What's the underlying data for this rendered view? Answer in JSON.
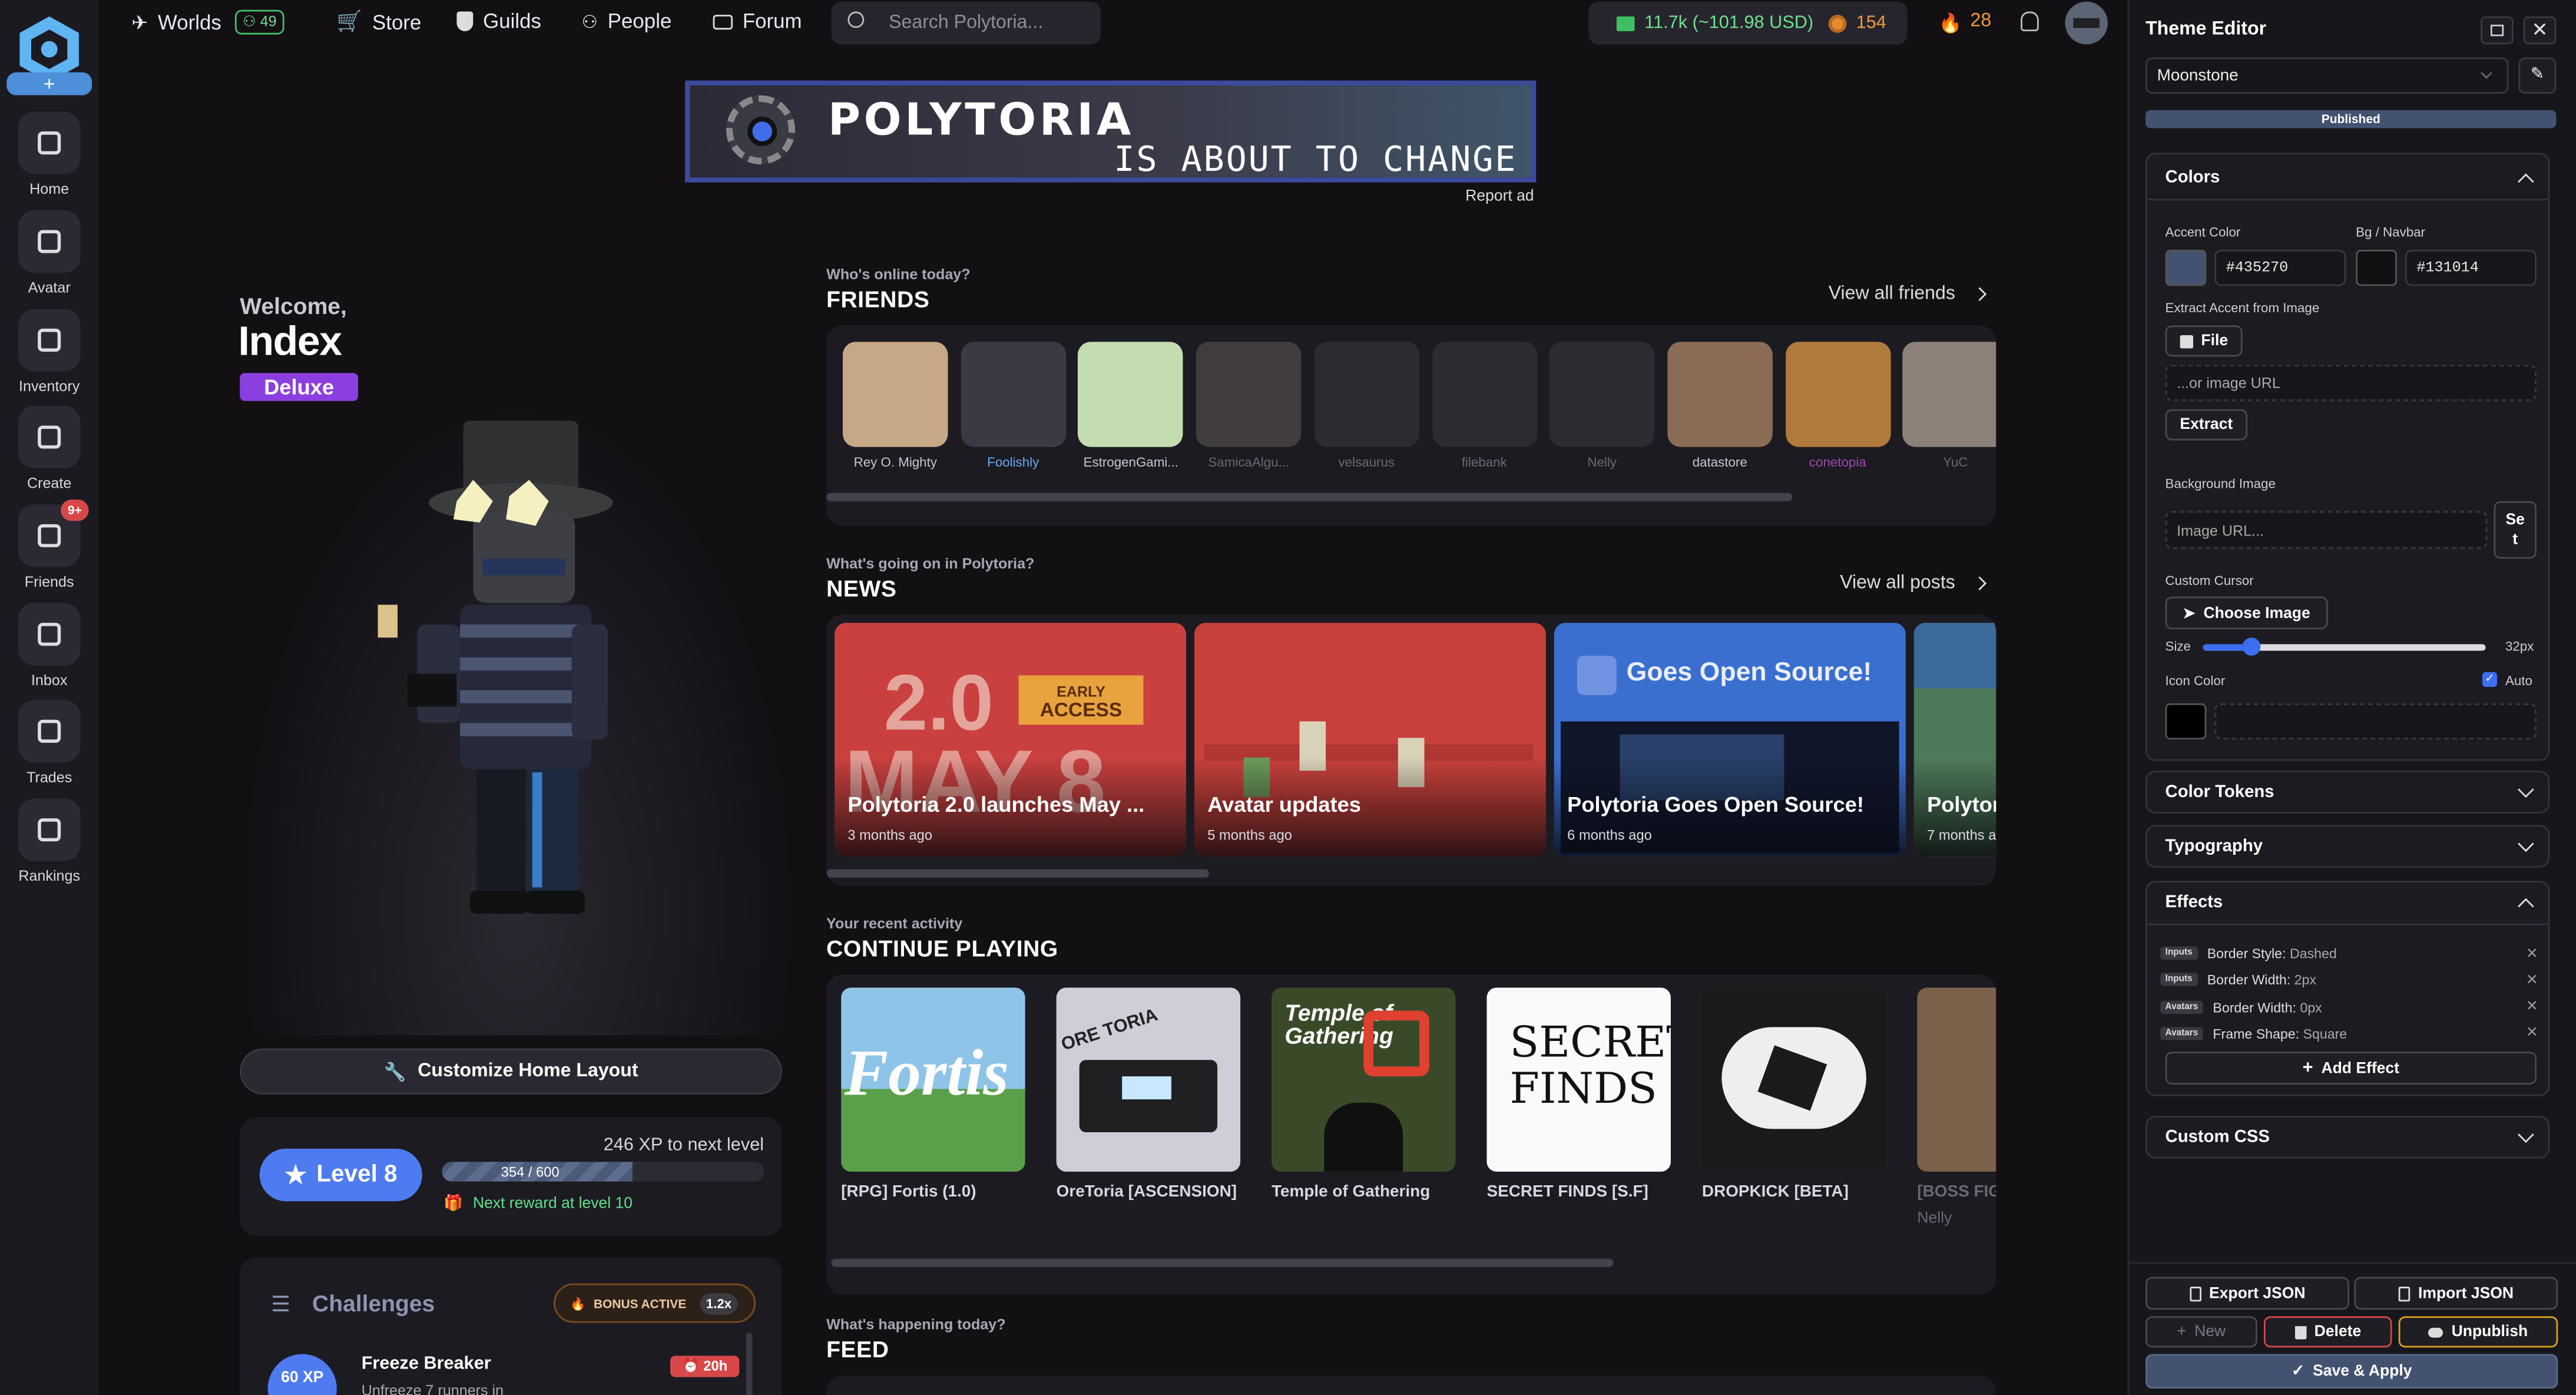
{
  "sidebar": {
    "items": [
      {
        "label": "Home",
        "icon": "home-icon"
      },
      {
        "label": "Avatar",
        "icon": "avatar-icon"
      },
      {
        "label": "Inventory",
        "icon": "inventory-icon"
      },
      {
        "label": "Create",
        "icon": "create-icon"
      },
      {
        "label": "Friends",
        "icon": "friends-icon",
        "badge": "9+"
      },
      {
        "label": "Inbox",
        "icon": "inbox-icon"
      },
      {
        "label": "Trades",
        "icon": "trades-icon"
      },
      {
        "label": "Rankings",
        "icon": "rankings-icon"
      }
    ]
  },
  "topbar": {
    "worlds": "Worlds",
    "worlds_count": "49",
    "store": "Store",
    "guilds": "Guilds",
    "people": "People",
    "forum": "Forum",
    "search_placeholder": "Search Polytoria...",
    "bricks": "11.7k (~101.98 USD)",
    "stars": "154",
    "streak": "28"
  },
  "ad": {
    "line1": "POLYTORIA",
    "line2": "IS ABOUT TO CHANGE",
    "report": "Report ad"
  },
  "profile": {
    "welcome": "Welcome,",
    "name": "Index",
    "tier": "Deluxe",
    "customize": "Customize Home Layout",
    "level": "Level 8",
    "xp_to_next": "246 XP to next level",
    "xp_progress": "354 / 600",
    "xp_fraction": 0.59,
    "next_reward": "Next reward at level 10"
  },
  "challenges": {
    "title": "Challenges",
    "bonus": "BONUS ACTIVE",
    "multiplier": "1.2x",
    "item": {
      "xp": "60 XP",
      "name": "Freeze Breaker",
      "desc": "Unfreeze 7 runners in",
      "timer": "20h"
    }
  },
  "friends": {
    "sub": "Who's online today?",
    "title": "FRIENDS",
    "view_all": "View all friends",
    "list": [
      {
        "name": "Rey O. Mighty",
        "color": "#c7a886"
      },
      {
        "name": "Foolishly",
        "color": "#3b3a44"
      },
      {
        "name": "EstrogenGami...",
        "color": "#c4ddb0"
      },
      {
        "name": "SamicaAlgu...",
        "color": "#5e5a52"
      },
      {
        "name": "velsaurus",
        "color": "#3a3940"
      },
      {
        "name": "filebank",
        "color": "#3a3940"
      },
      {
        "name": "Nelly",
        "color": "#3a3940"
      },
      {
        "name": "datastore",
        "color": "#8a6b55"
      },
      {
        "name": "conetopia",
        "color": "#b07a3c"
      },
      {
        "name": "YuC",
        "color": "#8c8178"
      }
    ]
  },
  "news": {
    "sub": "What's going on in Polytoria?",
    "title": "NEWS",
    "view_all": "View all posts",
    "big_text": "2.0",
    "big_text2": "MAY 8",
    "early": "EARLY",
    "access": "ACCESS",
    "open_source_banner": "Goes Open Source!",
    "posts": [
      {
        "title": "Polytoria 2.0 launches May ...",
        "date": "3 months ago"
      },
      {
        "title": "Avatar updates",
        "date": "5 months ago"
      },
      {
        "title": "Polytoria Goes Open Source!",
        "date": "6 months ago"
      },
      {
        "title": "Polytor",
        "date": "7 months a"
      }
    ]
  },
  "continue": {
    "sub": "Your recent activity",
    "title": "CONTINUE PLAYING",
    "games": [
      {
        "name": "[RPG] Fortis (1.0)",
        "thumb": "Fortis"
      },
      {
        "name": "OreToria [ASCENSION]",
        "thumb": "ORE TORIA"
      },
      {
        "name": "Temple of Gathering",
        "thumb": "Temple of Gathering"
      },
      {
        "name": "SECRET FINDS [S.F]",
        "thumb": "SECRET FINDS"
      },
      {
        "name": "DROPKICK [BETA]",
        "thumb": ""
      },
      {
        "name": "[BOSS FIG",
        "sub": "Nelly",
        "thumb": ""
      }
    ]
  },
  "feed": {
    "sub": "What's happening today?",
    "title": "FEED"
  },
  "editor": {
    "title": "Theme Editor",
    "theme_name": "Moonstone",
    "status": "Published",
    "colors": {
      "title": "Colors",
      "accent_label": "Accent Color",
      "accent_value": "#435270",
      "bg_label": "Bg / Navbar",
      "bg_value": "#131014",
      "extract_label": "Extract Accent from Image",
      "file_btn": "File",
      "image_url_placeholder": "...or image URL",
      "extract_btn": "Extract",
      "bg_image_label": "Background Image",
      "bg_image_placeholder": "Image URL...",
      "set_btn": "Set",
      "cursor_label": "Custom Cursor",
      "choose_image": "Choose Image",
      "size_label": "Size",
      "size_value": "32px",
      "size_fraction": 0.17,
      "icon_color_label": "Icon Color",
      "auto_label": "Auto"
    },
    "sections": {
      "tokens": "Color Tokens",
      "typography": "Typography",
      "effects": "Effects",
      "css": "Custom CSS"
    },
    "effects": [
      {
        "tag": "Inputs",
        "key": "Border Style:",
        "value": "Dashed"
      },
      {
        "tag": "Inputs",
        "key": "Border Width:",
        "value": "2px"
      },
      {
        "tag": "Avatars",
        "key": "Border Width:",
        "value": "0px"
      },
      {
        "tag": "Avatars",
        "key": "Frame Shape:",
        "value": "Square"
      }
    ],
    "add_effect": "Add Effect",
    "export": "Export JSON",
    "import": "Import JSON",
    "new": "New",
    "delete": "Delete",
    "unpublish": "Unpublish",
    "save": "Save & Apply"
  },
  "colors": {
    "accent": "#435270",
    "bg": "#131014",
    "level_blue": "#4f7bf0",
    "deluxe": "#8b3fe0",
    "danger": "#d84848",
    "warning": "#e0a020"
  }
}
